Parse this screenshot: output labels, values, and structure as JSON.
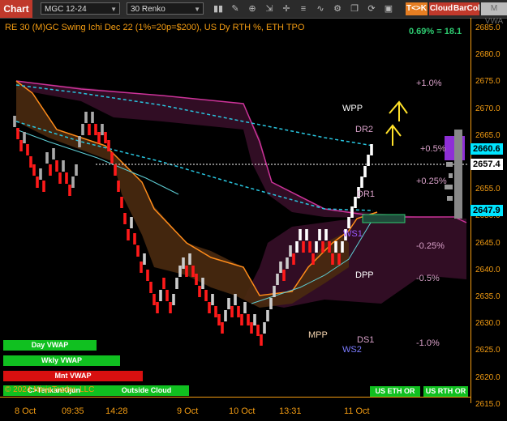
{
  "toolbar": {
    "chart_tab": "Chart",
    "instrument": "MGC 12-24",
    "bar_type": "30 Renko",
    "tk_button": "T<>K",
    "cloud_button": "Cloud",
    "barcol_button": "BarCol",
    "mvwa_button": "M VWA"
  },
  "chart": {
    "title": "RE 30 (M)GC Swing Ichi Dec 22 (1%=20p=$200), US Dy RTH %, ETH TPO",
    "change_readout": "0.69% = 18.1",
    "copyright": "© 2024 NinjaTrader, LLC",
    "watermark": "Outside Cloud"
  },
  "levels": {
    "plus1": "+1.0%",
    "plus05": "+0.5%",
    "plus025": "+0.25%",
    "minus025": "-0.25%",
    "minus05": "-0.5%",
    "minus1": "-1.0%",
    "wpp": "WPP",
    "dr2": "DR2",
    "dr1": "DR1",
    "ws1": "WS1",
    "dpp": "DPP",
    "mpp": "MPP",
    "ds1": "DS1",
    "ws2": "WS2"
  },
  "price_axis": {
    "ticks": [
      "2685.0",
      "2680.0",
      "2675.0",
      "2670.0",
      "2665.0",
      "2660.0",
      "2655.0",
      "2650.0",
      "2645.0",
      "2640.0",
      "2635.0",
      "2630.0",
      "2625.0",
      "2620.0",
      "2615.0"
    ],
    "tag_green": "2660.6",
    "tag_white": "2657.4",
    "tag_cyan": "2647.9"
  },
  "time_axis": {
    "ticks": [
      "8 Oct",
      "09:35",
      "14:28",
      "9 Oct",
      "10 Oct",
      "13:31",
      "11 Oct"
    ]
  },
  "legend": {
    "day_vwap": "Day VWAP",
    "wkly_vwap": "Wkly VWAP",
    "mnt_vwap": "Mnt VWAP",
    "c_tenkan": "C>TenkanKijun",
    "us_eth": "US ETH OR",
    "us_rth": "US RTH OR"
  },
  "colors": {
    "accent": "#f39c12",
    "up_bar": "#ffffff",
    "down_bar": "#ff1a1a",
    "cloud_bull": "#4a2a10",
    "cloud_bear": "#3a0f2a",
    "kijun": "#cc3399",
    "tenkan": "#ff8c1a",
    "vwap": "#29c6e0"
  }
}
